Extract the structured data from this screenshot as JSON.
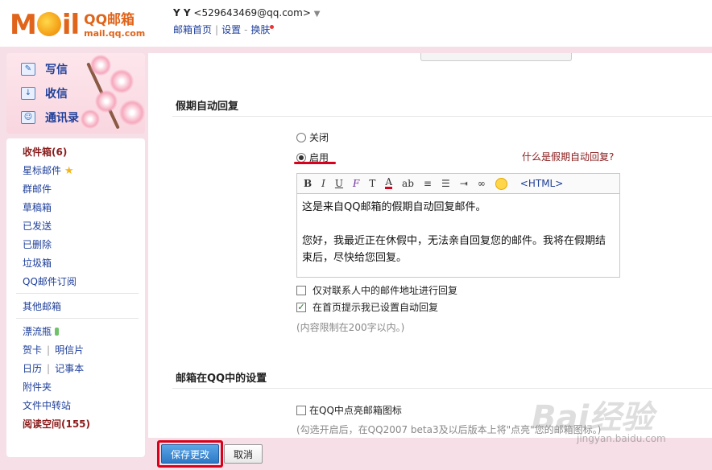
{
  "header": {
    "logo_mail": "Mail",
    "logo_cn": "QQ邮箱",
    "logo_url": "mail.qq.com",
    "user_name": "Y Y",
    "user_email": "<529643469@qq.com>",
    "links": [
      "邮箱首页",
      "设置",
      "换肤"
    ]
  },
  "sidebar": {
    "quick": [
      {
        "label": "写信",
        "icon": "write-icon"
      },
      {
        "label": "收信",
        "icon": "inbox-download-icon"
      },
      {
        "label": "通讯录",
        "icon": "contacts-icon"
      }
    ],
    "folders": {
      "inbox": "收件箱(6)",
      "starred": "星标邮件",
      "group": "群邮件",
      "drafts": "草稿箱",
      "sent": "已发送",
      "deleted": "已删除",
      "trash": "垃圾箱",
      "subscribe": "QQ邮件订阅",
      "other": "其他邮箱",
      "drift": "漂流瓶",
      "card": "贺卡",
      "postcard": "明信片",
      "calendar": "日历",
      "notes": "记事本",
      "attachments": "附件夹",
      "transfer": "文件中转站",
      "reading": "阅读空间(155)"
    }
  },
  "main": {
    "vacation": {
      "title": "假期自动回复",
      "off_label": "关闭",
      "on_label": "启用",
      "help_link": "什么是假期自动回复?",
      "toolbar": {
        "bold": "B",
        "italic": "I",
        "underline": "U",
        "font": "F",
        "size": "T",
        "color": "A",
        "bg": "ab",
        "html": "<HTML>"
      },
      "editor_line1": "这是来自QQ邮箱的假期自动回复邮件。",
      "editor_line2": "您好，我最近正在休假中，无法亲自回复您的邮件。我将在假期结束后，尽快给您回复。",
      "check1": "仅对联系人中的邮件地址进行回复",
      "check2": "在首页提示我已设置自动回复",
      "limit_note": "(内容限制在200字以内。)"
    },
    "qq_settings": {
      "title": "邮箱在QQ中的设置",
      "check_light": "在QQ中点亮邮箱图标",
      "note": "(勾选开启后，在QQ2007 beta3及以后版本上将\"点亮\"您的邮箱图标。)"
    }
  },
  "actions": {
    "save": "保存更改",
    "cancel": "取消"
  },
  "watermark": {
    "brand": "Bai经验",
    "url": "jingyan.baidu.com"
  }
}
